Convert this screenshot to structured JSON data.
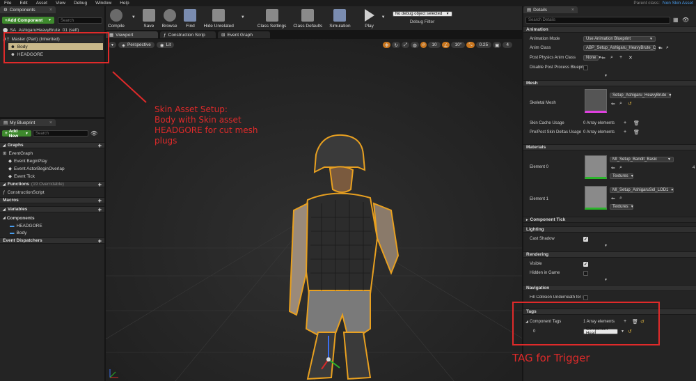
{
  "menu": {
    "items": [
      "File",
      "Edit",
      "Asset",
      "View",
      "Debug",
      "Window",
      "Help"
    ],
    "parent_label": "Parent class:",
    "parent_value": "Non Skin Asset"
  },
  "components_panel": {
    "tab": "Components",
    "add_label": "+Add Component",
    "search_placeholder": "Search",
    "self_item": "SA_AshigaruHeavyBrute_01 (self)",
    "master_item": "Master (Part) (Inherited)",
    "children": [
      "Body",
      "HEADGORE"
    ]
  },
  "blueprint_panel": {
    "tab": "My Blueprint",
    "add_label": "Add New",
    "search_placeholder": "Search",
    "graphs_label": "Graphs",
    "eventgraph": "EventGraph",
    "events": [
      "Event BeginPlay",
      "Event ActorBeginOverlap",
      "Event Tick"
    ],
    "functions_label": "Functions",
    "functions_count": "(19 Overridable)",
    "construction": "ConstructionScript",
    "macros_label": "Macros",
    "variables_label": "Variables",
    "components_label": "Components",
    "components": [
      "HEADGORE",
      "Body"
    ],
    "dispatchers_label": "Event Dispatchers"
  },
  "toolbar": {
    "buttons": [
      {
        "id": "compile",
        "label": "Compile"
      },
      {
        "id": "save",
        "label": "Save"
      },
      {
        "id": "browse",
        "label": "Browse"
      },
      {
        "id": "find",
        "label": "Find"
      },
      {
        "id": "hide",
        "label": "Hide Unrelated"
      },
      {
        "id": "class-settings",
        "label": "Class Settings"
      },
      {
        "id": "class-defaults",
        "label": "Class Defaults"
      },
      {
        "id": "simulation",
        "label": "Simulation"
      },
      {
        "id": "play",
        "label": "Play"
      }
    ],
    "debug_select": "No debug object selected",
    "debug_label": "Debug Filter"
  },
  "editor_tabs": [
    {
      "label": "Viewport",
      "icon": "viewport-icon"
    },
    {
      "label": "Construction Scrip",
      "icon": "function-icon"
    },
    {
      "label": "Event Graph",
      "icon": "graph-icon"
    }
  ],
  "viewport": {
    "perspective": "Perspective",
    "lit": "Lit",
    "grid": "10",
    "angle": "10°",
    "scale": "0.25",
    "cam": "4"
  },
  "annotations": {
    "skin": "Skin Asset Setup:\nBody with Skin asset\nHEADGORE for cut mesh\nplugs",
    "tag": "TAG for Trigger"
  },
  "details": {
    "tab": "Details",
    "search_placeholder": "Search Details",
    "animation": {
      "title": "Animation",
      "mode_label": "Animation Mode",
      "mode_value": "Use Animation Blueprint",
      "class_label": "Anim Class",
      "class_value": "ABP_Setup_Ashigaru_HeavyBrute_C",
      "post_label": "Post Physics Anim Class",
      "post_value": "None",
      "disable_label": "Disable Post Process Blueprint"
    },
    "mesh": {
      "title": "Mesh",
      "skel_label": "Skeletal Mesh",
      "skel_value": "Setup_Ashigaru_HeavyBrute",
      "cache_label": "Skin Cache Usage",
      "cache_value": "0 Array elements",
      "deltas_label": "Pre/Post Skin Deltas Usage",
      "deltas_value": "0 Array elements"
    },
    "materials": {
      "title": "Materials",
      "el0_label": "Element 0",
      "el0_value": "MI_Setup_Bandit_Basic",
      "el0_btn": "Textures",
      "el1_label": "Element 1",
      "el1_value": "MI_Setup_AshigaruSol_LOD1",
      "el1_btn": "Textures"
    },
    "component_tick": "Component Tick",
    "lighting": {
      "title": "Lighting",
      "cast_label": "Cast Shadow"
    },
    "rendering": {
      "title": "Rendering",
      "visible_label": "Visible",
      "hidden_label": "Hidden in Game"
    },
    "navigation": {
      "title": "Navigation",
      "fill_label": "Fill Collision Underneath for Navmesh"
    },
    "tags": {
      "title": "Tags",
      "ctags_label": "Component Tags",
      "ctags_value": "1 Array elements",
      "idx": "0",
      "tag_value": "Component Head"
    }
  },
  "colors": {
    "annotation": "#e02a2a",
    "accent": "#3e8a2d",
    "selection": "#c9b88a"
  }
}
